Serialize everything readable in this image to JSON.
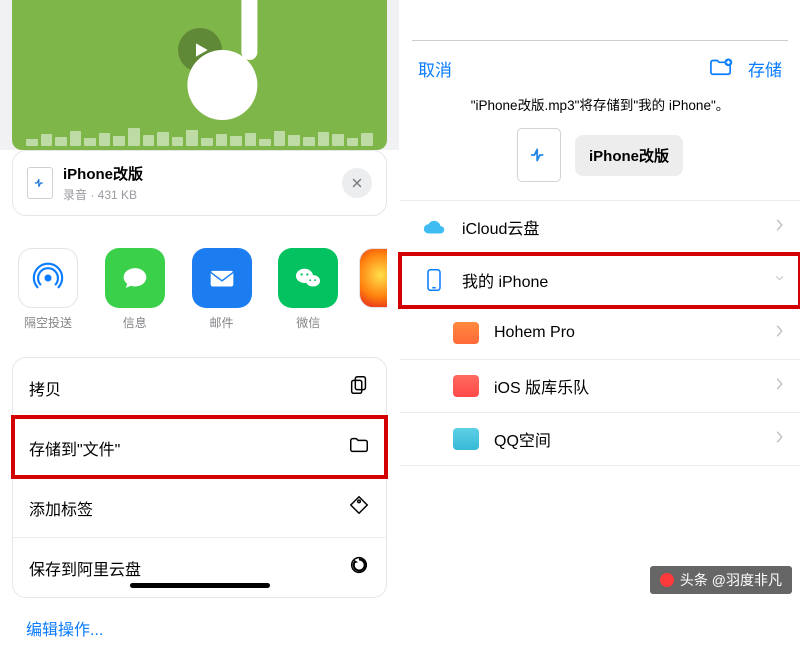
{
  "left": {
    "file": {
      "icon": "audio-file-icon",
      "name": "iPhone改版",
      "meta": "录音 · 431 KB"
    },
    "share": [
      {
        "icon": "airdrop-icon",
        "label": "隔空投送"
      },
      {
        "icon": "messages-icon",
        "label": "信息"
      },
      {
        "icon": "mail-icon",
        "label": "邮件"
      },
      {
        "icon": "wechat-icon",
        "label": "微信"
      },
      {
        "icon": "weibo-icon",
        "label": ""
      }
    ],
    "actions": {
      "copy": "拷贝",
      "save_files": "存储到\"文件\"",
      "add_tag": "添加标签",
      "save_aliyun": "保存到阿里云盘"
    },
    "edit_ops": "编辑操作..."
  },
  "right": {
    "nav": {
      "cancel": "取消",
      "save": "存储"
    },
    "info": "\"iPhone改版.mp3\"将存储到\"我的 iPhone\"。",
    "file_chip": "iPhone改版",
    "locations": {
      "icloud": "iCloud云盘",
      "my_iphone": "我的 iPhone",
      "sub": [
        {
          "icon": "folder-orange",
          "label": "Hohem Pro"
        },
        {
          "icon": "folder-red",
          "label": "iOS 版库乐队"
        },
        {
          "icon": "folder-cyan",
          "label": "QQ空间"
        }
      ]
    }
  },
  "watermark": "头条 @羽度非凡"
}
